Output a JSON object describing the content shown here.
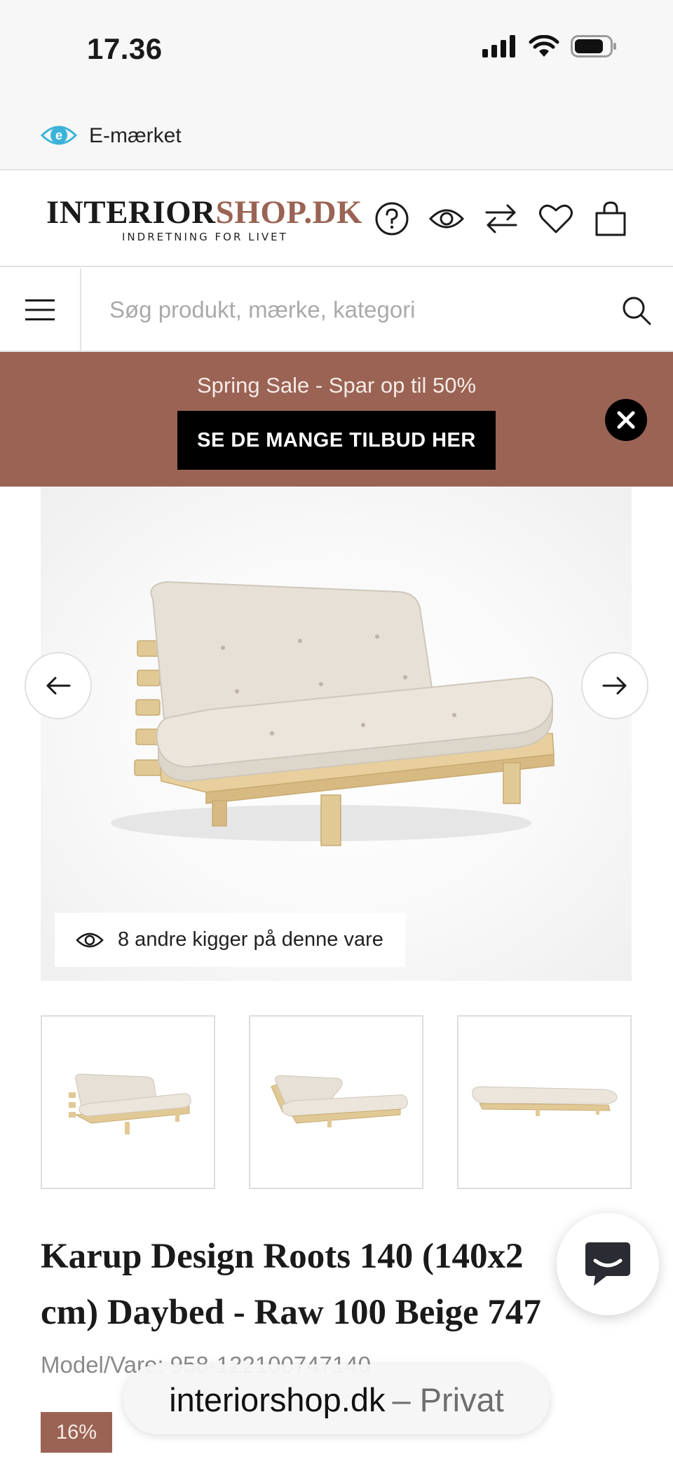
{
  "status_bar": {
    "time": "17.36"
  },
  "emark": {
    "label": "E-mærket"
  },
  "header": {
    "logo_main_part1": "INTERIOR",
    "logo_main_part2": "SHOP.DK",
    "logo_tagline": "INDRETNING FOR LIVET",
    "icons": [
      "help-icon",
      "eye-icon",
      "compare-icon",
      "heart-icon",
      "bag-icon"
    ]
  },
  "search": {
    "placeholder": "Søg produkt, mærke, kategori"
  },
  "promo": {
    "text": "Spring Sale - Spar op til 50%",
    "cta": "SE DE MANGE TILBUD HER",
    "background": "#9a6354"
  },
  "gallery": {
    "viewers_text": "8 andre kigger på denne vare",
    "thumbnail_count": 3
  },
  "product": {
    "title_line1": "Karup Design Roots 140 (140x2",
    "title_line2": "cm) Daybed - Raw 100 Beige 747",
    "model_label": "Model/Vare",
    "model_number": "958-122100747140",
    "discount": "16%"
  },
  "browser": {
    "url_domain": "interiorshop.dk",
    "url_suffix": "– Privat"
  },
  "colors": {
    "accent": "#9a6354",
    "text": "#1a1a1a",
    "muted": "#8a8a8a"
  }
}
